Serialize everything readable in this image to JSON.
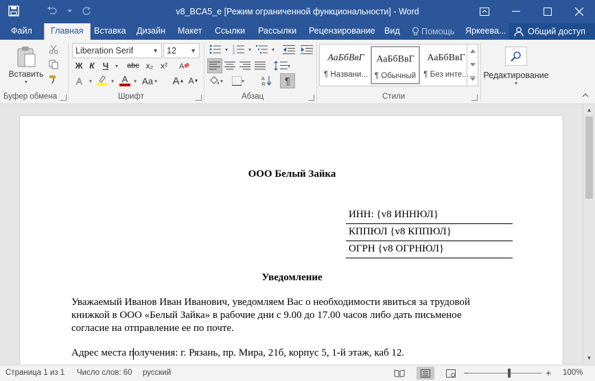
{
  "window": {
    "title": "v8_BCA5_e [Режим ограниченной функциональности] - Word"
  },
  "tabs": [
    {
      "label": "Файл"
    },
    {
      "label": "Главная"
    },
    {
      "label": "Вставка"
    },
    {
      "label": "Дизайн"
    },
    {
      "label": "Макет"
    },
    {
      "label": "Ссылки"
    },
    {
      "label": "Рассылки"
    },
    {
      "label": "Рецензирование"
    },
    {
      "label": "Вид"
    },
    {
      "label": "Помощь"
    },
    {
      "label": "Яркеева..."
    }
  ],
  "share_label": "Общий доступ",
  "ribbon": {
    "clipboard": {
      "paste_label": "Вставить",
      "group_label": "Буфер обмена"
    },
    "font": {
      "family": "Liberation Serif",
      "size": "12",
      "bold": "Ж",
      "italic": "К",
      "underline": "Ч",
      "strike": "abc",
      "subscript": "x₂",
      "superscript": "x²",
      "grow": "A",
      "shrink": "A",
      "case": "Aa",
      "group_label": "Шрифт"
    },
    "paragraph": {
      "group_label": "Абзац",
      "pilcrow": "¶"
    },
    "styles": {
      "items": [
        {
          "sample": "АаБбВвГ",
          "name": "¶ Названи..."
        },
        {
          "sample": "АаБбВвГ",
          "name": "¶ Обычный"
        },
        {
          "sample": "АаБбВвГ",
          "name": "¶ Без инте..."
        }
      ],
      "group_label": "Стили"
    },
    "editing": {
      "label": "Редактирование"
    }
  },
  "document": {
    "company": "ООО Белый Зайка",
    "inn": "ИНН: {v8 ИННЮЛ}",
    "kpp": "КППЮЛ {v8 КППЮЛ}",
    "ogrn": "ОГРН {v8 ОГРНЮЛ}",
    "heading": "Уведомление",
    "body_lines": [
      "Уважаемый Иванов Иван Иванович, уведомляем Вас о необходимости явиться за трудовой",
      "книжкой в ООО «Белый Зайка» в рабочие дни с 9.00 до 17.00 часов либо дать письменое",
      "согласие на отправление ее по почте."
    ],
    "address": "Адрес места получения: г. Рязань, пр. Мира, 21б, корпус 5, 1-й этаж,  каб 12."
  },
  "status": {
    "page": "Страница 1 из 1",
    "words": "Число слов: 60",
    "language": "русский",
    "zoom": "100%",
    "zoom_minus": "−",
    "zoom_plus": "+"
  },
  "colors": {
    "brand": "#2b579a",
    "text_highlight": "#ffff00",
    "font_color": "#c00000"
  }
}
